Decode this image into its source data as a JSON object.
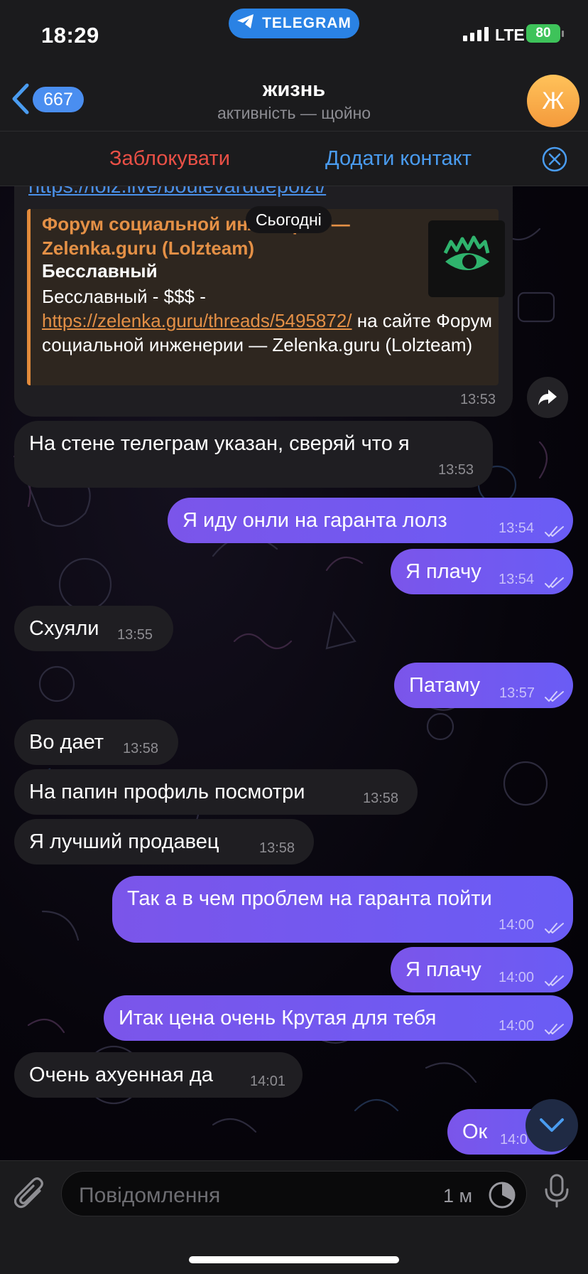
{
  "status": {
    "time": "18:29",
    "app_pill": "TELEGRAM",
    "network": "LTE",
    "battery": "80"
  },
  "header": {
    "back_count": "667",
    "title": "жизнь",
    "subtitle": "активність — щойно",
    "avatar_letter": "Ж"
  },
  "actions": {
    "block": "Заблокувати",
    "add_contact": "Додати контакт"
  },
  "date_chip": "Сьогодні",
  "link_message": {
    "url": "https://lolz.live/boulevarddepolzt/",
    "preview_site": "Форум социальной инженерии — Zelenka.guru (Lolzteam)",
    "preview_title": "Бесславный",
    "preview_desc_prefix": "Бесславный - $$$ - ",
    "preview_desc_link": "https://zelenka.guru/threads/5495872/",
    "preview_desc_suffix": " на сайте Форум социальной инженерии —  Zelenka.guru (Lolzteam)",
    "time": "13:53"
  },
  "messages": [
    {
      "dir": "in",
      "text": "На стене телеграм указан, сверяй что я",
      "time": "13:53"
    },
    {
      "dir": "out",
      "text": "Я иду онли на гаранта лолз",
      "time": "13:54"
    },
    {
      "dir": "out",
      "text": "Я плачу",
      "time": "13:54"
    },
    {
      "dir": "in",
      "text": "Схуяли",
      "time": "13:55"
    },
    {
      "dir": "out",
      "text": "Патаму",
      "time": "13:57"
    },
    {
      "dir": "in",
      "text": "Во дает",
      "time": "13:58"
    },
    {
      "dir": "in",
      "text": "На папин профиль посмотри",
      "time": "13:58"
    },
    {
      "dir": "in",
      "text": "Я лучший продавец",
      "time": "13:58"
    },
    {
      "dir": "out",
      "text": "Так а в чем проблем на гаранта пойти",
      "time": "14:00"
    },
    {
      "dir": "out",
      "text": "Я плачу",
      "time": "14:00"
    },
    {
      "dir": "out",
      "text": "Итак цена очень Крутая для тебя",
      "time": "14:00"
    },
    {
      "dir": "in",
      "text": "Очень ахуенная да",
      "time": "14:01"
    },
    {
      "dir": "out",
      "text": "Ок",
      "time": "14:0"
    }
  ],
  "input": {
    "placeholder": "Повідомлення",
    "timer": "1 м"
  },
  "icons": [
    "telegram-plane-icon",
    "signal-icon",
    "back-chevron-icon",
    "close-circle-icon",
    "forward-icon",
    "double-check-icon",
    "scroll-down-icon",
    "paperclip-icon",
    "timer-icon",
    "microphone-icon"
  ],
  "colors": {
    "accent_blue": "#4a9cf0",
    "danger_red": "#ea5046",
    "outgoing_bubble": "#7060f0",
    "incoming_bubble": "#1f1e22",
    "link_preview_accent": "#e49046"
  }
}
